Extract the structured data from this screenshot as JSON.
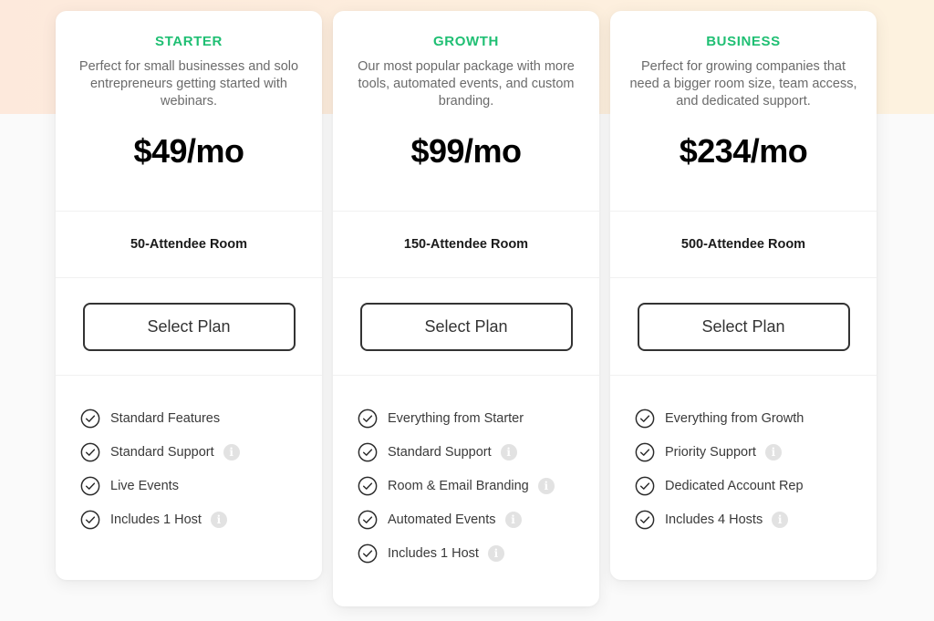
{
  "colors": {
    "accent": "#1fbf73",
    "band_left": "#fde9dc",
    "band_right": "#fdf2df",
    "page_bg": "#fafafa"
  },
  "plans": [
    {
      "tier": "STARTER",
      "description": "Perfect for small businesses and solo entrepreneurs getting started with webinars.",
      "price": "$49/mo",
      "room": "50-Attendee Room",
      "cta": "Select Plan",
      "features": [
        {
          "label": "Standard Features",
          "info": false
        },
        {
          "label": "Standard Support",
          "info": true
        },
        {
          "label": "Live Events",
          "info": false
        },
        {
          "label": "Includes 1 Host",
          "info": true
        }
      ]
    },
    {
      "tier": "GROWTH",
      "description": "Our most popular package with more tools, automated events, and custom branding.",
      "price": "$99/mo",
      "room": "150-Attendee Room",
      "cta": "Select Plan",
      "features": [
        {
          "label": "Everything from Starter",
          "info": false
        },
        {
          "label": "Standard Support",
          "info": true
        },
        {
          "label": "Room & Email Branding",
          "info": true
        },
        {
          "label": "Automated Events",
          "info": true
        },
        {
          "label": "Includes 1 Host",
          "info": true
        }
      ]
    },
    {
      "tier": "BUSINESS",
      "description": "Perfect for growing companies that need a bigger room size, team access, and dedicated support.",
      "price": "$234/mo",
      "room": "500-Attendee Room",
      "cta": "Select Plan",
      "features": [
        {
          "label": "Everything from Growth",
          "info": false
        },
        {
          "label": "Priority Support",
          "info": true
        },
        {
          "label": "Dedicated Account Rep",
          "info": false
        },
        {
          "label": "Includes 4 Hosts",
          "info": true
        }
      ]
    }
  ],
  "icons": {
    "check": "check-circle-icon",
    "info": "info-icon",
    "info_glyph": "i"
  }
}
